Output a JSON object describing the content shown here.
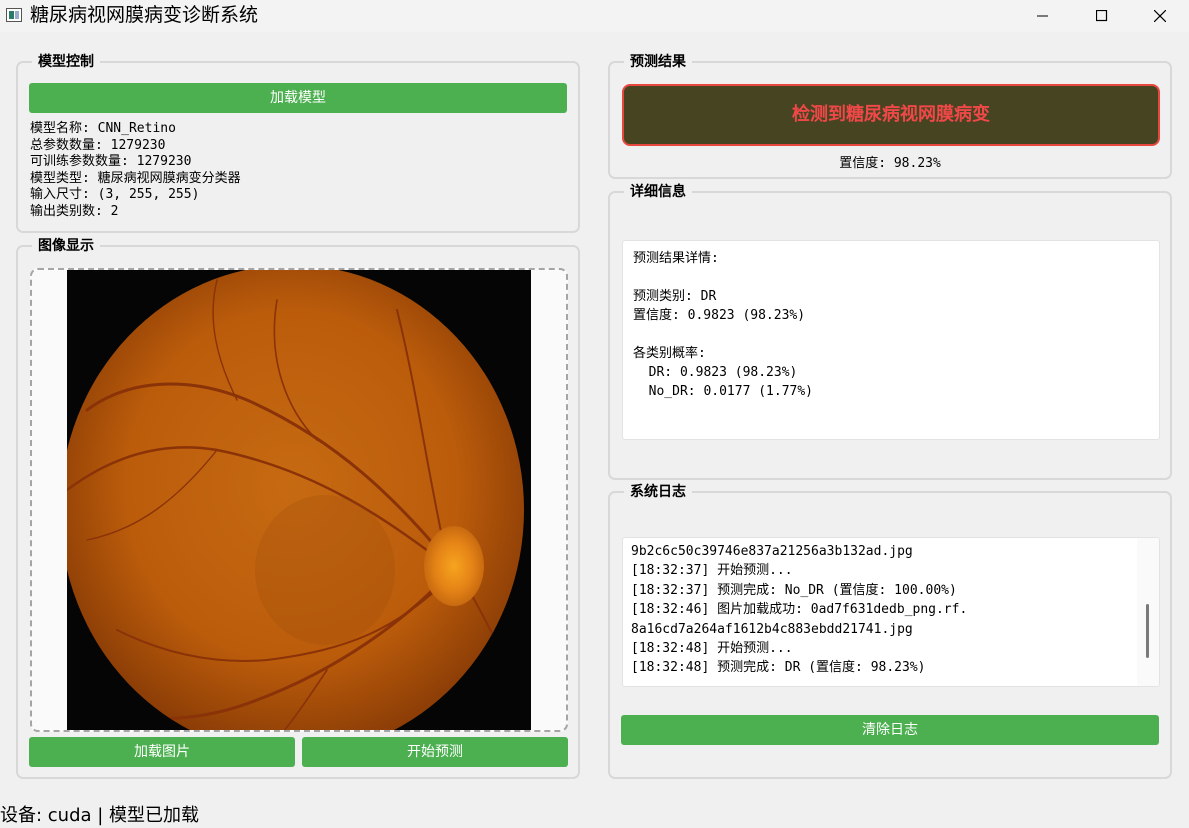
{
  "window": {
    "title": "糖尿病视网膜病变诊断系统"
  },
  "model_control": {
    "title": "模型控制",
    "load_button": "加载模型",
    "info": [
      "模型名称: CNN_Retino",
      "总参数数量: 1279230",
      "可训练参数数量: 1279230",
      "模型类型: 糖尿病视网膜病变分类器",
      "输入尺寸: (3, 255, 255)",
      "输出类别数: 2"
    ]
  },
  "image_display": {
    "title": "图像显示",
    "load_image_button": "加载图片",
    "predict_button": "开始预测"
  },
  "prediction": {
    "title": "预测结果",
    "result_text": "检测到糖尿病视网膜病变",
    "confidence_text": "置信度: 98.23%"
  },
  "details": {
    "title": "详细信息",
    "lines": [
      "预测结果详情:",
      "",
      "预测类别: DR",
      "置信度: 0.9823 (98.23%)",
      "",
      "各类别概率:",
      "  DR: 0.9823 (98.23%)",
      "  No_DR: 0.0177 (1.77%)"
    ]
  },
  "system_log": {
    "title": "系统日志",
    "lines": [
      "9b2c6c50c39746e837a21256a3b132ad.jpg",
      "[18:32:37] 开始预测...",
      "[18:32:37] 预测完成: No_DR (置信度: 100.00%)",
      "[18:32:46] 图片加载成功: 0ad7f631dedb_png.rf.",
      "8a16cd7a264af1612b4c883ebdd21741.jpg",
      "[18:32:48] 开始预测...",
      "[18:32:48] 预测完成: DR (置信度: 98.23%)"
    ],
    "clear_button": "清除日志"
  },
  "status_bar": {
    "text": "设备: cuda | 模型已加载"
  },
  "colors": {
    "button_green": "#4caf50",
    "result_bg": "#464421",
    "result_border": "#e8473f",
    "result_text": "#f04848"
  },
  "icons": [
    "app-icon",
    "minimize-icon",
    "maximize-icon",
    "close-icon"
  ]
}
